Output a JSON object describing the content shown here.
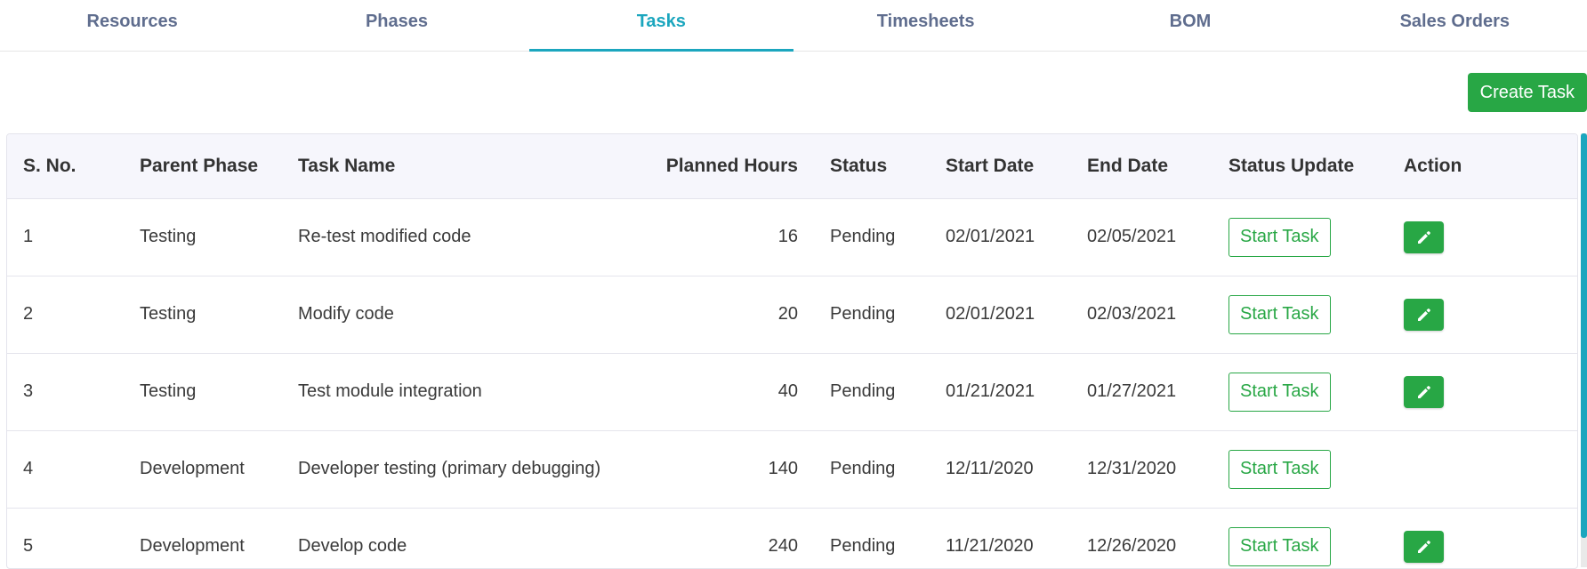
{
  "tabs": [
    {
      "label": "Resources",
      "active": false
    },
    {
      "label": "Phases",
      "active": false
    },
    {
      "label": "Tasks",
      "active": true
    },
    {
      "label": "Timesheets",
      "active": false
    },
    {
      "label": "BOM",
      "active": false
    },
    {
      "label": "Sales Orders",
      "active": false
    }
  ],
  "toolbar": {
    "create_label": "Create Task"
  },
  "table": {
    "headers": {
      "sno": "S. No.",
      "phase": "Parent Phase",
      "task": "Task Name",
      "hours": "Planned Hours",
      "status": "Status",
      "start": "Start Date",
      "end": "End Date",
      "status_update": "Status Update",
      "action": "Action"
    },
    "rows": [
      {
        "sno": "1",
        "phase": "Testing",
        "task": "Re-test modified code",
        "hours": "16",
        "status": "Pending",
        "start": "02/01/2021",
        "end": "02/05/2021",
        "button": "Start Task",
        "editable": true
      },
      {
        "sno": "2",
        "phase": "Testing",
        "task": "Modify code",
        "hours": "20",
        "status": "Pending",
        "start": "02/01/2021",
        "end": "02/03/2021",
        "button": "Start Task",
        "editable": true
      },
      {
        "sno": "3",
        "phase": "Testing",
        "task": "Test module integration",
        "hours": "40",
        "status": "Pending",
        "start": "01/21/2021",
        "end": "01/27/2021",
        "button": "Start Task",
        "editable": true
      },
      {
        "sno": "4",
        "phase": "Development",
        "task": "Developer testing (primary debugging)",
        "hours": "140",
        "status": "Pending",
        "start": "12/11/2020",
        "end": "12/31/2020",
        "button": "Start Task",
        "editable": false
      },
      {
        "sno": "5",
        "phase": "Development",
        "task": "Develop code",
        "hours": "240",
        "status": "Pending",
        "start": "11/21/2020",
        "end": "12/26/2020",
        "button": "Start Task",
        "editable": true
      }
    ]
  },
  "icons": {
    "edit": "pencil-icon"
  },
  "colors": {
    "accent": "#1ba6be",
    "success": "#28a745",
    "tab_text": "#5f6d8e"
  }
}
